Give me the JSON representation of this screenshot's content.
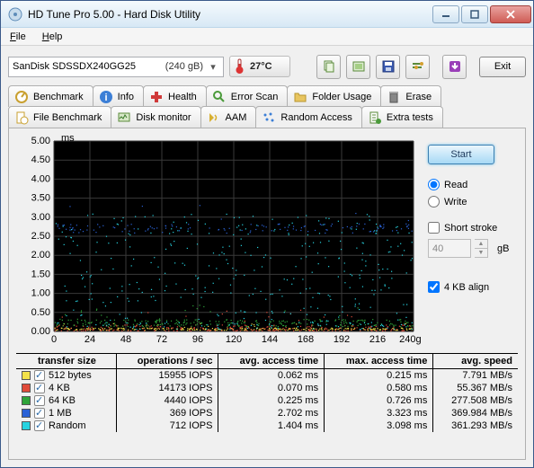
{
  "window": {
    "title": "HD Tune Pro 5.00 - Hard Disk Utility"
  },
  "menu": {
    "file": "File",
    "help": "Help"
  },
  "drive": {
    "name": "SanDisk SDSSDX240GG25",
    "capacity": "(240 gB)"
  },
  "temperature": "27°C",
  "toolbar": {
    "exit": "Exit"
  },
  "tabs_top": [
    {
      "key": "benchmark",
      "label": "Benchmark"
    },
    {
      "key": "info",
      "label": "Info"
    },
    {
      "key": "health",
      "label": "Health"
    },
    {
      "key": "errorscan",
      "label": "Error Scan"
    },
    {
      "key": "folderusage",
      "label": "Folder Usage"
    },
    {
      "key": "erase",
      "label": "Erase"
    }
  ],
  "tabs_bottom": [
    {
      "key": "filebench",
      "label": "File Benchmark"
    },
    {
      "key": "diskmon",
      "label": "Disk monitor"
    },
    {
      "key": "aam",
      "label": "AAM"
    },
    {
      "key": "random",
      "label": "Random Access"
    },
    {
      "key": "extra",
      "label": "Extra tests"
    }
  ],
  "side": {
    "start": "Start",
    "read": "Read",
    "write": "Write",
    "short_stroke": "Short stroke",
    "short_stroke_val": "40",
    "short_stroke_unit": "gB",
    "align": "4 KB align"
  },
  "chart_data": {
    "type": "scatter",
    "ylabel_unit": "ms",
    "ylim": [
      0,
      5.0
    ],
    "yticks": [
      0.0,
      0.5,
      1.0,
      1.5,
      2.0,
      2.5,
      3.0,
      3.5,
      4.0,
      4.5,
      5.0
    ],
    "xlim": [
      0,
      240
    ],
    "xticks": [
      0,
      24,
      48,
      72,
      96,
      120,
      144,
      168,
      192,
      216,
      240
    ],
    "xunit": "gB",
    "series": [
      {
        "name": "512 bytes",
        "color": "#f3e24a",
        "mean_ms": 0.062,
        "max_ms": 0.215
      },
      {
        "name": "4 KB",
        "color": "#e04b3a",
        "mean_ms": 0.07,
        "max_ms": 0.58
      },
      {
        "name": "64 KB",
        "color": "#2fa43a",
        "mean_ms": 0.225,
        "max_ms": 0.726
      },
      {
        "name": "1 MB",
        "color": "#2b62d6",
        "mean_ms": 2.702,
        "max_ms": 3.323
      },
      {
        "name": "Random",
        "color": "#27d3e0",
        "mean_ms": 1.404,
        "max_ms": 3.098
      }
    ]
  },
  "results": {
    "headers": [
      "transfer size",
      "operations / sec",
      "avg. access time",
      "max. access time",
      "avg. speed"
    ],
    "rows": [
      {
        "color": "#f3e24a",
        "label": "512 bytes",
        "iops": "15955 IOPS",
        "avg": "0.062 ms",
        "max": "0.215 ms",
        "speed": "7.791 MB/s"
      },
      {
        "color": "#e04b3a",
        "label": "4 KB",
        "iops": "14173 IOPS",
        "avg": "0.070 ms",
        "max": "0.580 ms",
        "speed": "55.367 MB/s"
      },
      {
        "color": "#2fa43a",
        "label": "64 KB",
        "iops": "4440 IOPS",
        "avg": "0.225 ms",
        "max": "0.726 ms",
        "speed": "277.508 MB/s"
      },
      {
        "color": "#2b62d6",
        "label": "1 MB",
        "iops": "369 IOPS",
        "avg": "2.702 ms",
        "max": "3.323 ms",
        "speed": "369.984 MB/s"
      },
      {
        "color": "#27d3e0",
        "label": "Random",
        "iops": "712 IOPS",
        "avg": "1.404 ms",
        "max": "3.098 ms",
        "speed": "361.293 MB/s"
      }
    ]
  }
}
